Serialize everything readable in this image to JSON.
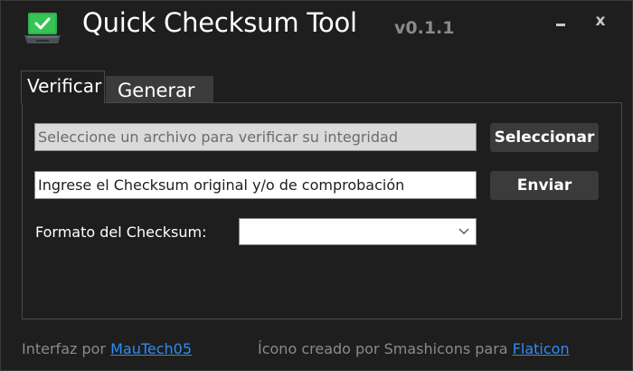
{
  "titlebar": {
    "title": "Quick Checksum Tool",
    "version": "v0.1.1",
    "minimize_icon": "minimize-icon",
    "close_glyph": "x"
  },
  "tabs": [
    {
      "label": "Verificar",
      "active": true
    },
    {
      "label": "Generar",
      "active": false
    }
  ],
  "verify": {
    "file_placeholder": "Seleccione un archivo para verificar su integridad",
    "select_button": "Seleccionar",
    "checksum_placeholder": "Ingrese el Checksum original y/o de comprobación",
    "send_button": "Enviar",
    "format_label": "Formato del Checksum:",
    "format_value": ""
  },
  "footer": {
    "interface_prefix": "Interfaz por ",
    "interface_link": "MauTech05",
    "icon_prefix": "Ícono creado por Smashicons para ",
    "icon_link": "Flaticon"
  },
  "colors": {
    "background": "#1e1e1e",
    "button": "#3b3b3b",
    "link": "#2f8cf0",
    "muted_text": "#8a8a8a",
    "icon_green": "#2fb24c"
  }
}
